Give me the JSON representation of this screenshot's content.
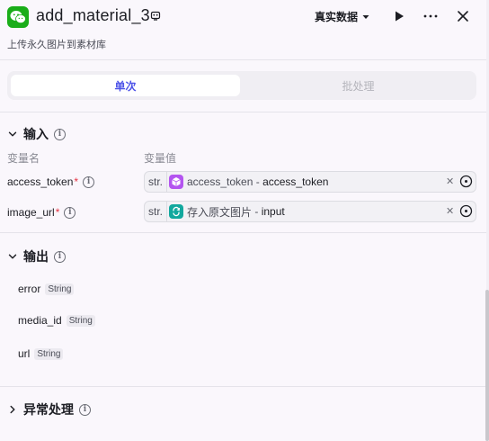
{
  "header": {
    "title": "add_material_3",
    "subtitle": "上传永久图片到素材库",
    "data_mode_label": "真实数据"
  },
  "tabs": [
    {
      "label": "单次",
      "active": true
    },
    {
      "label": "批处理",
      "active": false
    }
  ],
  "inputs": {
    "section_label": "输入",
    "col_name": "变量名",
    "col_value": "变量值",
    "params": [
      {
        "name": "access_token",
        "required_mark": "*",
        "type": "str.",
        "node_name": "access_token",
        "separator": " - ",
        "ref_var": "access_token",
        "node_icon": "cube-icon",
        "node_color": "#b455f0"
      },
      {
        "name": "image_url",
        "required_mark": "*",
        "type": "str.",
        "node_name": "存入原文图片",
        "separator": " - ",
        "ref_var": "input",
        "node_icon": "loop-icon",
        "node_color": "#12a89e"
      }
    ]
  },
  "outputs": {
    "section_label": "输出",
    "items": [
      {
        "name": "error",
        "type": "String"
      },
      {
        "name": "media_id",
        "type": "String"
      },
      {
        "name": "url",
        "type": "String"
      }
    ]
  },
  "exception": {
    "section_label": "异常处理"
  },
  "colors": {
    "accent": "#4d53e8",
    "brand": "#1aad19",
    "required": "#e53242"
  }
}
